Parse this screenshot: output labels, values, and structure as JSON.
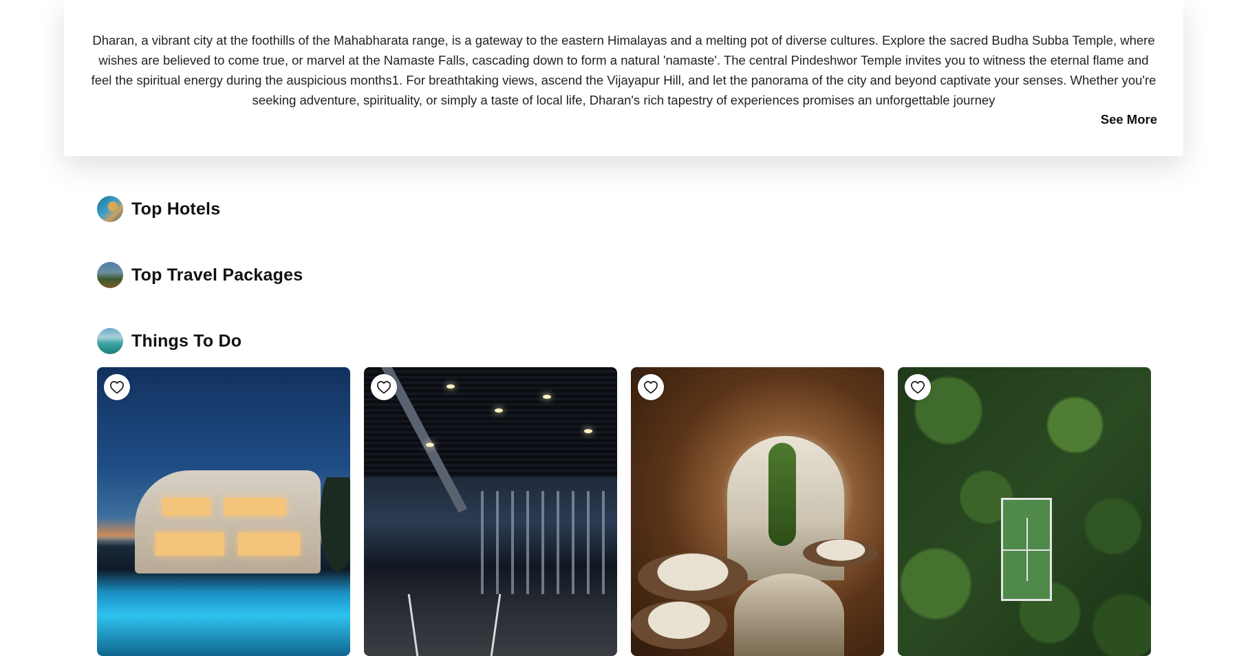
{
  "intro": {
    "description": "Dharan, a vibrant city at the foothills of the Mahabharata range, is a gateway to the eastern Himalayas and a melting pot of diverse cultures. Explore the sacred Budha Subba Temple, where wishes are believed to come true, or marvel at the Namaste Falls, cascading down to form a natural 'namaste'. The central Pindeshwor Temple invites you to witness the eternal flame and feel the spiritual energy during the auspicious months1. For breathtaking views, ascend the Vijayapur Hill, and let the panorama of the city and beyond captivate your senses. Whether you're seeking adventure, spirituality, or simply a taste of local life, Dharan's rich tapestry of experiences promises an unforgettable journey",
    "see_more_label": "See More"
  },
  "sections": {
    "hotels": {
      "title": "Top Hotels"
    },
    "packages": {
      "title": "Top Travel Packages"
    },
    "things_to_do": {
      "title": "Things To Do"
    }
  },
  "cards": [
    {
      "image": "villa-pool-dusk",
      "favorite_icon": "heart-outline-icon"
    },
    {
      "image": "gym-interior",
      "favorite_icon": "heart-outline-icon"
    },
    {
      "image": "cave-lounge",
      "favorite_icon": "heart-outline-icon"
    },
    {
      "image": "aerial-forest-tennis-court",
      "favorite_icon": "heart-outline-icon"
    }
  ]
}
